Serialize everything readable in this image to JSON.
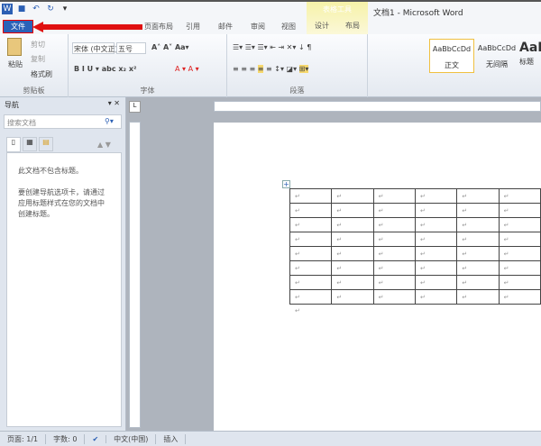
{
  "window": {
    "title": "文档1 - Microsoft Word",
    "context_tab_group": "表格工具"
  },
  "qat": {
    "icons": [
      "word-logo-icon",
      "save-icon",
      "undo-icon",
      "redo-icon",
      "customize-icon"
    ]
  },
  "tabs": {
    "file": "文件",
    "items": [
      "页面布局",
      "引用",
      "邮件",
      "审阅",
      "视图",
      "设计",
      "布局"
    ]
  },
  "ribbon": {
    "clipboard": {
      "label": "剪贴板",
      "paste": "粘贴",
      "cut": "剪切",
      "copy": "复制",
      "format_painter": "格式刷"
    },
    "font": {
      "label": "字体",
      "font_name": "宋体 (中文正)",
      "font_size": "五号"
    },
    "paragraph": {
      "label": "段落"
    },
    "styles": [
      {
        "preview": "AaBbCcDd",
        "name": "正文"
      },
      {
        "preview": "AaBbCcDd",
        "name": "无间隔"
      },
      {
        "preview": "AaB",
        "name": "标题"
      }
    ]
  },
  "nav": {
    "title": "导航",
    "search_placeholder": "搜索文档",
    "message1": "此文档不包含标题。",
    "message2": "要创建导航选项卡，请通过应用标题样式在您的文档中创建标题。"
  },
  "table": {
    "rows": 8,
    "cols": 6,
    "cell_mark": "↵"
  },
  "paragraph_mark": "↵",
  "status": {
    "page": "页面: 1/1",
    "words": "字数: 0",
    "language": "中文(中国)",
    "mode": "插入"
  },
  "colors": {
    "file_tab": "#2a62b8",
    "arrow": "#e01010",
    "context": "#f6f2a8"
  }
}
